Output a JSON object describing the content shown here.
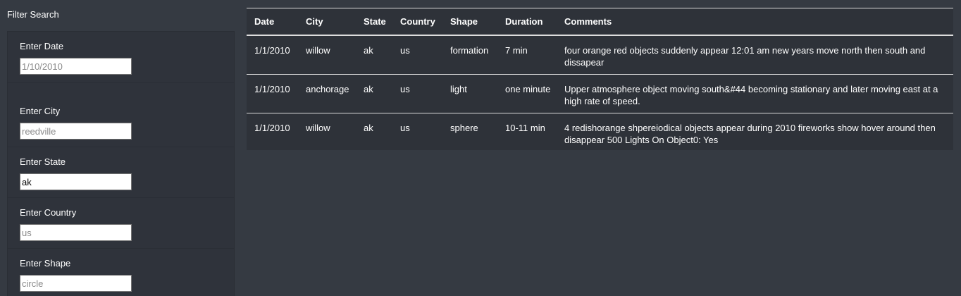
{
  "sidebar": {
    "heading": "Filter Search",
    "filters": [
      {
        "label": "Enter Date",
        "placeholder": "1/10/2010",
        "value": ""
      },
      {
        "label": "Enter City",
        "placeholder": "reedville",
        "value": ""
      },
      {
        "label": "Enter State",
        "placeholder": "",
        "value": "ak"
      },
      {
        "label": "Enter Country",
        "placeholder": "us",
        "value": ""
      },
      {
        "label": "Enter Shape",
        "placeholder": "circle",
        "value": ""
      }
    ]
  },
  "table": {
    "headers": [
      "Date",
      "City",
      "State",
      "Country",
      "Shape",
      "Duration",
      "Comments"
    ],
    "rows": [
      [
        "1/1/2010",
        "willow",
        "ak",
        "us",
        "formation",
        "7 min",
        "four orange red objects suddenly appear 12:01 am new years move north then south and dissapear"
      ],
      [
        "1/1/2010",
        "anchorage",
        "ak",
        "us",
        "light",
        "one minute",
        "Upper atmosphere object moving south&#44 becoming stationary and later moving east at a high rate of speed."
      ],
      [
        "1/1/2010",
        "willow",
        "ak",
        "us",
        "sphere",
        "10-11 min",
        "4 redishorange shpereiodical objects appear during 2010 fireworks show hover around then disappear 500 Lights On Object0: Yes"
      ]
    ]
  }
}
